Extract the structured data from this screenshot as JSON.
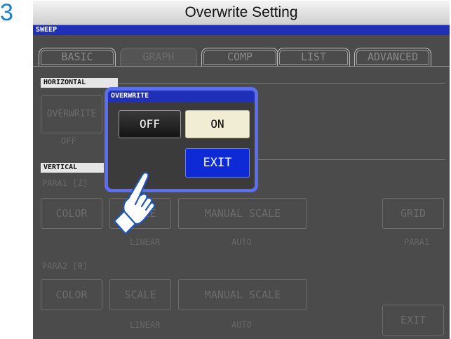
{
  "step_number": "3",
  "title": "Overwrite Setting",
  "screen": {
    "mode_label": "SWEEP",
    "tabs": [
      "BASIC",
      "GRAPH",
      "COMP",
      "LIST",
      "ADVANCED"
    ],
    "active_tab": "GRAPH",
    "horizontal": {
      "label": "HORIZONTAL",
      "overwrite_button": "OVERWRITE",
      "overwrite_value": "OFF"
    },
    "vertical": {
      "label": "VERTICAL",
      "para1_label": "PARA1 [Z]",
      "para1_color": "COLOR",
      "para1_scale": "SCALE",
      "para1_manual_scale": "MANUAL SCALE",
      "para1_scale_value": "LINEAR",
      "para1_manual_value": "AUTO",
      "para2_label": "PARA2 [θ]",
      "para2_color": "COLOR",
      "para2_scale": "SCALE",
      "para2_manual_scale": "MANUAL SCALE",
      "para2_scale_value": "LINEAR",
      "para2_manual_value": "AUTO"
    },
    "grid_button": "GRID",
    "grid_value": "PARA1",
    "exit_button": "EXIT"
  },
  "popup": {
    "title": "OVERWRITE",
    "off_label": "OFF",
    "on_label": "ON",
    "selected": "ON",
    "exit_label": "EXIT"
  },
  "icons": {
    "pointer": "hand-pointer-icon"
  },
  "colors": {
    "step_number": "#1a7fd0",
    "header_blue": "#1f2fb7",
    "popup_border": "#5c6ef0",
    "exit_button": "#0e2ad6",
    "selected_on": "#f1ecd4"
  }
}
